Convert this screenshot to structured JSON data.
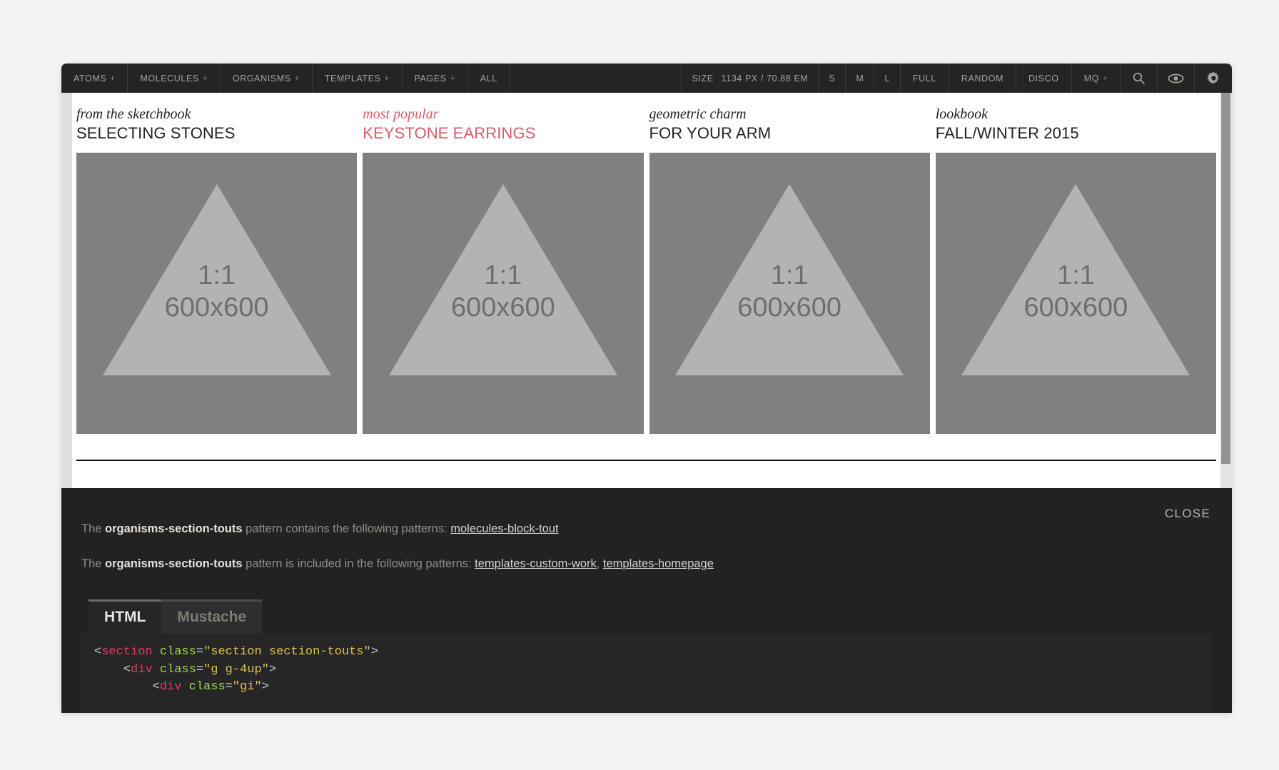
{
  "toolbar": {
    "nav_items": [
      {
        "label": "ATOMS",
        "has_plus": true
      },
      {
        "label": "MOLECULES",
        "has_plus": true
      },
      {
        "label": "ORGANISMS",
        "has_plus": true
      },
      {
        "label": "TEMPLATES",
        "has_plus": true
      },
      {
        "label": "PAGES",
        "has_plus": true
      },
      {
        "label": "ALL",
        "has_plus": false
      }
    ],
    "size_label": "SIZE",
    "size_value": "1134 PX / 70.88 EM",
    "size_buttons": [
      "S",
      "M",
      "L",
      "FULL",
      "RANDOM",
      "DISCO"
    ],
    "mq_label": "MQ",
    "mq_plus": "+",
    "icons": [
      "search-icon",
      "eye-icon",
      "gear-icon"
    ],
    "plus_glyph": "+"
  },
  "touts": [
    {
      "eyebrow": "from the sketchbook",
      "title": "SELECTING STONES",
      "accent": false,
      "image": {
        "ratio": "1:1",
        "dims": "600x600"
      }
    },
    {
      "eyebrow": "most popular",
      "title": "KEYSTONE EARRINGS",
      "accent": true,
      "image": {
        "ratio": "1:1",
        "dims": "600x600"
      }
    },
    {
      "eyebrow": "geometric charm",
      "title": "FOR YOUR ARM",
      "accent": false,
      "image": {
        "ratio": "1:1",
        "dims": "600x600"
      }
    },
    {
      "eyebrow": "lookbook",
      "title": "FALL/WINTER 2015",
      "accent": false,
      "image": {
        "ratio": "1:1",
        "dims": "600x600"
      }
    }
  ],
  "info_panel": {
    "close_label": "CLOSE",
    "lineage_contains": {
      "prefix": "The ",
      "pattern_name": "organisms-section-touts",
      "middle": " pattern contains the following patterns: ",
      "links": [
        "molecules-block-tout"
      ]
    },
    "lineage_included": {
      "prefix": "The ",
      "pattern_name": "organisms-section-touts",
      "middle": " pattern is included in the following patterns: ",
      "links": [
        "templates-custom-work",
        "templates-homepage"
      ],
      "separator": ", "
    },
    "tabs": [
      {
        "label": "HTML",
        "active": true
      },
      {
        "label": "Mustache",
        "active": false
      }
    ],
    "code_lines": [
      {
        "indent": "",
        "tokens": [
          {
            "t": "punc",
            "v": "<"
          },
          {
            "t": "tag",
            "v": "section"
          },
          {
            "t": "punc",
            "v": " "
          },
          {
            "t": "attr",
            "v": "class"
          },
          {
            "t": "eq",
            "v": "="
          },
          {
            "t": "str",
            "v": "\"section section-touts\""
          },
          {
            "t": "punc",
            "v": ">"
          }
        ]
      },
      {
        "indent": "    ",
        "tokens": [
          {
            "t": "punc",
            "v": "<"
          },
          {
            "t": "tag",
            "v": "div"
          },
          {
            "t": "punc",
            "v": " "
          },
          {
            "t": "attr",
            "v": "class"
          },
          {
            "t": "eq",
            "v": "="
          },
          {
            "t": "str",
            "v": "\"g g-4up\""
          },
          {
            "t": "punc",
            "v": ">"
          }
        ]
      },
      {
        "indent": "        ",
        "tokens": [
          {
            "t": "punc",
            "v": "<"
          },
          {
            "t": "tag",
            "v": "div"
          },
          {
            "t": "punc",
            "v": " "
          },
          {
            "t": "attr",
            "v": "class"
          },
          {
            "t": "eq",
            "v": "="
          },
          {
            "t": "str",
            "v": "\"gi\""
          },
          {
            "t": "punc",
            "v": ">"
          }
        ]
      }
    ]
  },
  "colors": {
    "toolbar_bg": "#242424",
    "panel_bg": "#222222",
    "accent_pink": "#dd5a6a",
    "placeholder_bg": "#808080",
    "placeholder_triangle": "#b3b3b3"
  }
}
